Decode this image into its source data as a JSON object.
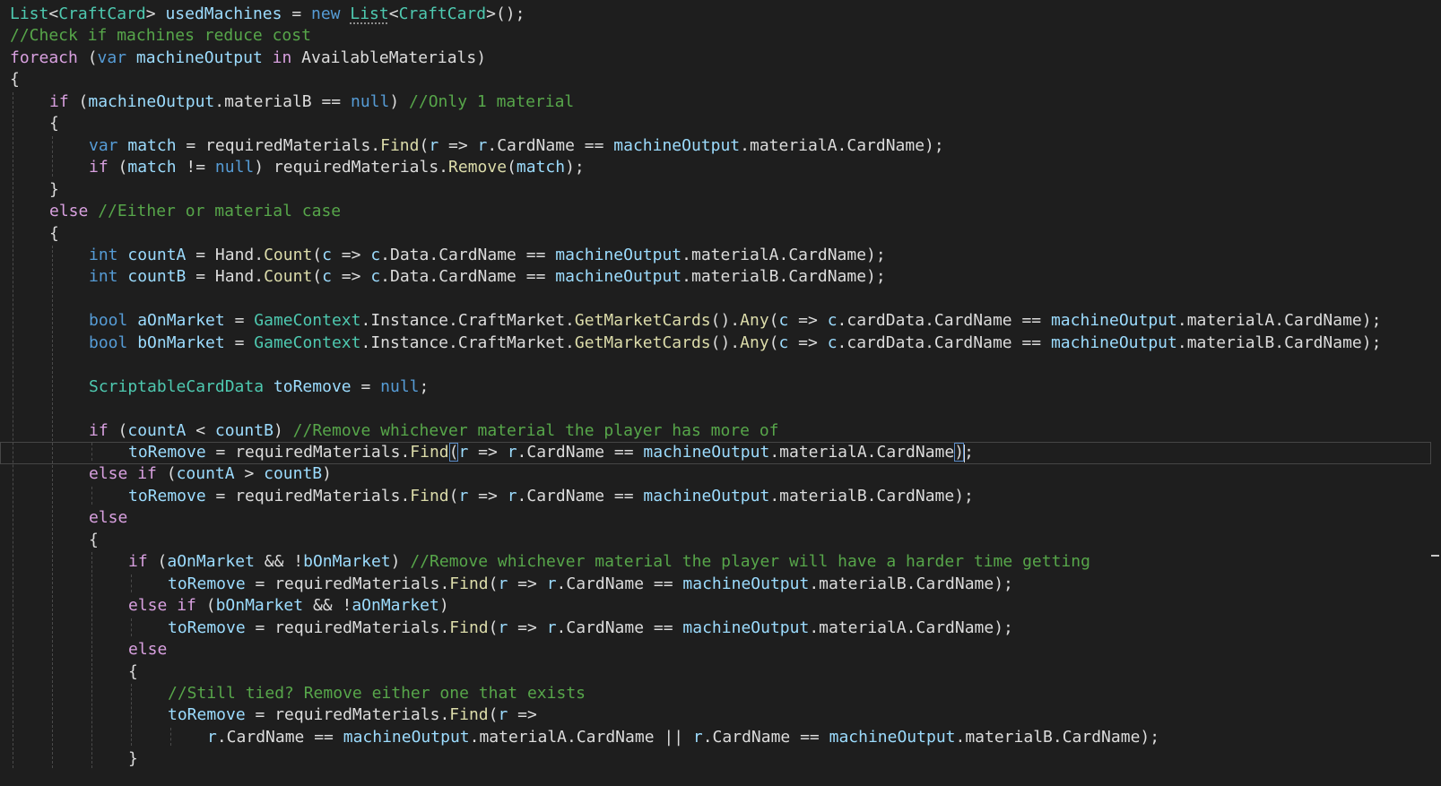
{
  "editor": {
    "cursor_line_index": 20,
    "lines": [
      {
        "indent": 0,
        "tokens": [
          [
            "List",
            "type"
          ],
          [
            "<",
            "plain"
          ],
          [
            "CraftCard",
            "type"
          ],
          [
            "> ",
            "plain"
          ],
          [
            "usedMachines",
            "local"
          ],
          [
            " = ",
            "plain"
          ],
          [
            "new",
            "keyword"
          ],
          [
            " ",
            "plain"
          ],
          [
            "List",
            "type squiggle"
          ],
          [
            "<",
            "plain"
          ],
          [
            "CraftCard",
            "type"
          ],
          [
            ">();",
            "plain"
          ]
        ]
      },
      {
        "indent": 0,
        "tokens": [
          [
            "//Check if machines reduce cost",
            "comment"
          ]
        ]
      },
      {
        "indent": 0,
        "tokens": [
          [
            "foreach",
            "control"
          ],
          [
            " (",
            "plain"
          ],
          [
            "var",
            "keyword"
          ],
          [
            " ",
            "plain"
          ],
          [
            "machineOutput",
            "local"
          ],
          [
            " ",
            "plain"
          ],
          [
            "in",
            "control"
          ],
          [
            " AvailableMaterials)",
            "plain"
          ]
        ]
      },
      {
        "indent": 0,
        "tokens": [
          [
            "{",
            "plain"
          ]
        ]
      },
      {
        "indent": 1,
        "tokens": [
          [
            "if",
            "control"
          ],
          [
            " (",
            "plain"
          ],
          [
            "machineOutput",
            "local"
          ],
          [
            ".materialB == ",
            "plain"
          ],
          [
            "null",
            "keyword"
          ],
          [
            ") ",
            "plain"
          ],
          [
            "//Only 1 material",
            "comment"
          ]
        ]
      },
      {
        "indent": 1,
        "tokens": [
          [
            "{",
            "plain"
          ]
        ]
      },
      {
        "indent": 2,
        "tokens": [
          [
            "var",
            "keyword"
          ],
          [
            " ",
            "plain"
          ],
          [
            "match",
            "local"
          ],
          [
            " = requiredMaterials.",
            "plain"
          ],
          [
            "Find",
            "method"
          ],
          [
            "(",
            "plain"
          ],
          [
            "r",
            "local"
          ],
          [
            " => ",
            "plain"
          ],
          [
            "r",
            "local"
          ],
          [
            ".CardName == ",
            "plain"
          ],
          [
            "machineOutput",
            "local"
          ],
          [
            ".materialA.CardName);",
            "plain"
          ]
        ]
      },
      {
        "indent": 2,
        "tokens": [
          [
            "if",
            "control"
          ],
          [
            " (",
            "plain"
          ],
          [
            "match",
            "local"
          ],
          [
            " != ",
            "plain"
          ],
          [
            "null",
            "keyword"
          ],
          [
            ") requiredMaterials.",
            "plain"
          ],
          [
            "Remove",
            "method"
          ],
          [
            "(",
            "plain"
          ],
          [
            "match",
            "local"
          ],
          [
            ");",
            "plain"
          ]
        ]
      },
      {
        "indent": 1,
        "tokens": [
          [
            "}",
            "plain"
          ]
        ]
      },
      {
        "indent": 1,
        "tokens": [
          [
            "else",
            "control"
          ],
          [
            " ",
            "plain"
          ],
          [
            "//Either or material case",
            "comment"
          ]
        ]
      },
      {
        "indent": 1,
        "tokens": [
          [
            "{",
            "plain"
          ]
        ]
      },
      {
        "indent": 2,
        "tokens": [
          [
            "int",
            "keyword"
          ],
          [
            " ",
            "plain"
          ],
          [
            "countA",
            "local"
          ],
          [
            " = Hand.",
            "plain"
          ],
          [
            "Count",
            "method"
          ],
          [
            "(",
            "plain"
          ],
          [
            "c",
            "local"
          ],
          [
            " => ",
            "plain"
          ],
          [
            "c",
            "local"
          ],
          [
            ".Data.CardName == ",
            "plain"
          ],
          [
            "machineOutput",
            "local"
          ],
          [
            ".materialA.CardName);",
            "plain"
          ]
        ]
      },
      {
        "indent": 2,
        "tokens": [
          [
            "int",
            "keyword"
          ],
          [
            " ",
            "plain"
          ],
          [
            "countB",
            "local"
          ],
          [
            " = Hand.",
            "plain"
          ],
          [
            "Count",
            "method"
          ],
          [
            "(",
            "plain"
          ],
          [
            "c",
            "local"
          ],
          [
            " => ",
            "plain"
          ],
          [
            "c",
            "local"
          ],
          [
            ".Data.CardName == ",
            "plain"
          ],
          [
            "machineOutput",
            "local"
          ],
          [
            ".materialB.CardName);",
            "plain"
          ]
        ]
      },
      {
        "indent": 0,
        "tokens": []
      },
      {
        "indent": 2,
        "tokens": [
          [
            "bool",
            "keyword"
          ],
          [
            " ",
            "plain"
          ],
          [
            "aOnMarket",
            "local"
          ],
          [
            " = ",
            "plain"
          ],
          [
            "GameContext",
            "type"
          ],
          [
            ".Instance.CraftMarket.",
            "plain"
          ],
          [
            "GetMarketCards",
            "method"
          ],
          [
            "().",
            "plain"
          ],
          [
            "Any",
            "method"
          ],
          [
            "(",
            "plain"
          ],
          [
            "c",
            "local"
          ],
          [
            " => ",
            "plain"
          ],
          [
            "c",
            "local"
          ],
          [
            ".cardData.CardName == ",
            "plain"
          ],
          [
            "machineOutput",
            "local"
          ],
          [
            ".materialA.CardName);",
            "plain"
          ]
        ]
      },
      {
        "indent": 2,
        "tokens": [
          [
            "bool",
            "keyword"
          ],
          [
            " ",
            "plain"
          ],
          [
            "bOnMarket",
            "local"
          ],
          [
            " = ",
            "plain"
          ],
          [
            "GameContext",
            "type"
          ],
          [
            ".Instance.CraftMarket.",
            "plain"
          ],
          [
            "GetMarketCards",
            "method"
          ],
          [
            "().",
            "plain"
          ],
          [
            "Any",
            "method"
          ],
          [
            "(",
            "plain"
          ],
          [
            "c",
            "local"
          ],
          [
            " => ",
            "plain"
          ],
          [
            "c",
            "local"
          ],
          [
            ".cardData.CardName == ",
            "plain"
          ],
          [
            "machineOutput",
            "local"
          ],
          [
            ".materialB.CardName);",
            "plain"
          ]
        ]
      },
      {
        "indent": 0,
        "tokens": []
      },
      {
        "indent": 2,
        "tokens": [
          [
            "ScriptableCardData",
            "type"
          ],
          [
            " ",
            "plain"
          ],
          [
            "toRemove",
            "local"
          ],
          [
            " = ",
            "plain"
          ],
          [
            "null",
            "keyword"
          ],
          [
            ";",
            "plain"
          ]
        ]
      },
      {
        "indent": 0,
        "tokens": []
      },
      {
        "indent": 2,
        "tokens": [
          [
            "if",
            "control"
          ],
          [
            " (",
            "plain"
          ],
          [
            "countA",
            "local"
          ],
          [
            " < ",
            "plain"
          ],
          [
            "countB",
            "local"
          ],
          [
            ") ",
            "plain"
          ],
          [
            "//Remove whichever material the player has more of",
            "comment"
          ]
        ]
      },
      {
        "indent": 3,
        "tokens": [
          [
            "toRemove",
            "local"
          ],
          [
            " = requiredMaterials.",
            "plain"
          ],
          [
            "Find",
            "method"
          ],
          [
            "(",
            "plain brace"
          ],
          [
            "r",
            "local"
          ],
          [
            " => ",
            "plain"
          ],
          [
            "r",
            "local"
          ],
          [
            ".CardName == ",
            "plain"
          ],
          [
            "machineOutput",
            "local"
          ],
          [
            ".materialA.CardName",
            "plain"
          ],
          [
            ")",
            "plain brace"
          ],
          [
            ";",
            "plain"
          ]
        ]
      },
      {
        "indent": 2,
        "tokens": [
          [
            "else",
            "control"
          ],
          [
            " ",
            "plain"
          ],
          [
            "if",
            "control"
          ],
          [
            " (",
            "plain"
          ],
          [
            "countA",
            "local"
          ],
          [
            " > ",
            "plain"
          ],
          [
            "countB",
            "local"
          ],
          [
            ")",
            "plain"
          ]
        ]
      },
      {
        "indent": 3,
        "tokens": [
          [
            "toRemove",
            "local"
          ],
          [
            " = requiredMaterials.",
            "plain"
          ],
          [
            "Find",
            "method"
          ],
          [
            "(",
            "plain"
          ],
          [
            "r",
            "local"
          ],
          [
            " => ",
            "plain"
          ],
          [
            "r",
            "local"
          ],
          [
            ".CardName == ",
            "plain"
          ],
          [
            "machineOutput",
            "local"
          ],
          [
            ".materialB.CardName);",
            "plain"
          ]
        ]
      },
      {
        "indent": 2,
        "tokens": [
          [
            "else",
            "control"
          ]
        ]
      },
      {
        "indent": 2,
        "tokens": [
          [
            "{",
            "plain"
          ]
        ]
      },
      {
        "indent": 3,
        "tokens": [
          [
            "if",
            "control"
          ],
          [
            " (",
            "plain"
          ],
          [
            "aOnMarket",
            "local"
          ],
          [
            " && !",
            "plain"
          ],
          [
            "bOnMarket",
            "local"
          ],
          [
            ") ",
            "plain"
          ],
          [
            "//Remove whichever material the player will have a harder time getting",
            "comment"
          ]
        ]
      },
      {
        "indent": 4,
        "tokens": [
          [
            "toRemove",
            "local"
          ],
          [
            " = requiredMaterials.",
            "plain"
          ],
          [
            "Find",
            "method"
          ],
          [
            "(",
            "plain"
          ],
          [
            "r",
            "local"
          ],
          [
            " => ",
            "plain"
          ],
          [
            "r",
            "local"
          ],
          [
            ".CardName == ",
            "plain"
          ],
          [
            "machineOutput",
            "local"
          ],
          [
            ".materialB.CardName);",
            "plain"
          ]
        ]
      },
      {
        "indent": 3,
        "tokens": [
          [
            "else",
            "control"
          ],
          [
            " ",
            "plain"
          ],
          [
            "if",
            "control"
          ],
          [
            " (",
            "plain"
          ],
          [
            "bOnMarket",
            "local"
          ],
          [
            " && !",
            "plain"
          ],
          [
            "aOnMarket",
            "local"
          ],
          [
            ")",
            "plain"
          ]
        ]
      },
      {
        "indent": 4,
        "tokens": [
          [
            "toRemove",
            "local"
          ],
          [
            " = requiredMaterials.",
            "plain"
          ],
          [
            "Find",
            "method"
          ],
          [
            "(",
            "plain"
          ],
          [
            "r",
            "local"
          ],
          [
            " => ",
            "plain"
          ],
          [
            "r",
            "local"
          ],
          [
            ".CardName == ",
            "plain"
          ],
          [
            "machineOutput",
            "local"
          ],
          [
            ".materialA.CardName);",
            "plain"
          ]
        ]
      },
      {
        "indent": 3,
        "tokens": [
          [
            "else",
            "control"
          ]
        ]
      },
      {
        "indent": 3,
        "tokens": [
          [
            "{",
            "plain"
          ]
        ]
      },
      {
        "indent": 4,
        "tokens": [
          [
            "//Still tied? Remove either one that exists",
            "comment"
          ]
        ]
      },
      {
        "indent": 4,
        "tokens": [
          [
            "toRemove",
            "local"
          ],
          [
            " = requiredMaterials.",
            "plain"
          ],
          [
            "Find",
            "method"
          ],
          [
            "(",
            "plain"
          ],
          [
            "r",
            "local"
          ],
          [
            " =>",
            "plain"
          ]
        ]
      },
      {
        "indent": 5,
        "tokens": [
          [
            "r",
            "local"
          ],
          [
            ".CardName == ",
            "plain"
          ],
          [
            "machineOutput",
            "local"
          ],
          [
            ".materialA.CardName || ",
            "plain"
          ],
          [
            "r",
            "local"
          ],
          [
            ".CardName == ",
            "plain"
          ],
          [
            "machineOutput",
            "local"
          ],
          [
            ".materialB.CardName);",
            "plain"
          ]
        ]
      },
      {
        "indent": 3,
        "tokens": [
          [
            "}",
            "plain"
          ]
        ]
      }
    ]
  }
}
